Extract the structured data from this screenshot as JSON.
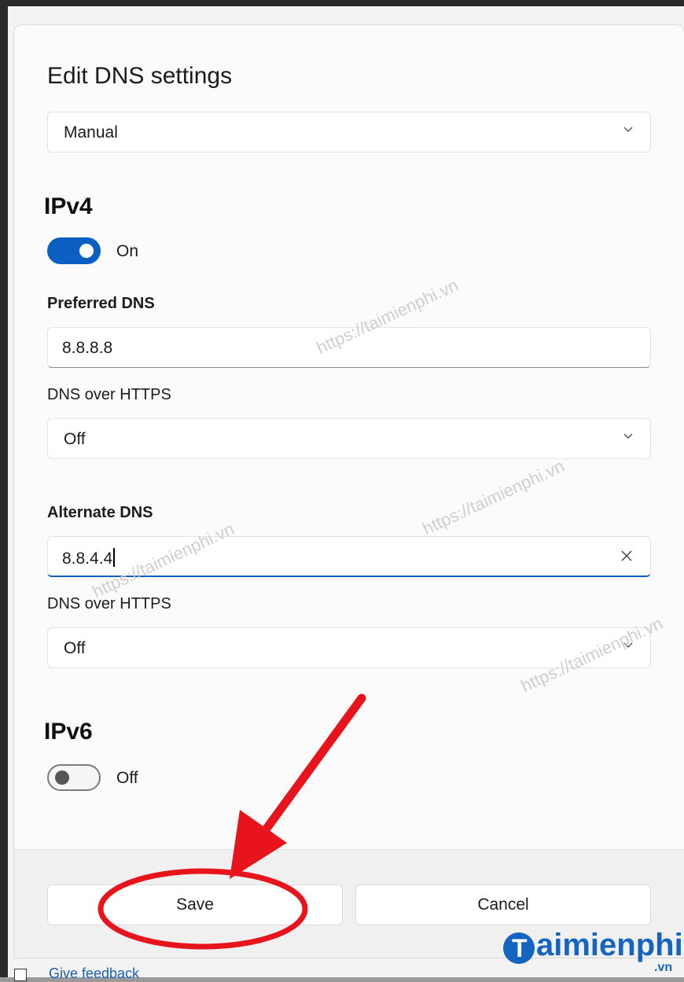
{
  "dialog": {
    "title": "Edit DNS settings",
    "mode_select": "Manual"
  },
  "ipv4": {
    "heading": "IPv4",
    "toggle_state": "On",
    "preferred_label": "Preferred DNS",
    "preferred_value": "8.8.8.8",
    "preferred_https_label": "DNS over HTTPS",
    "preferred_https_value": "Off",
    "alternate_label": "Alternate DNS",
    "alternate_value": "8.8.4.4",
    "alternate_https_label": "DNS over HTTPS",
    "alternate_https_value": "Off"
  },
  "ipv6": {
    "heading": "IPv6",
    "toggle_state": "Off"
  },
  "footer": {
    "save_label": "Save",
    "cancel_label": "Cancel"
  },
  "background": {
    "link_text": "Give feedback"
  },
  "watermark": {
    "text": "https://taimienphi.vn",
    "logo_text": "aimienphi",
    "logo_initial": "T",
    "logo_sub": ".vn"
  },
  "colors": {
    "accent": "#0b5fc3",
    "annotation": "#e8141b"
  }
}
